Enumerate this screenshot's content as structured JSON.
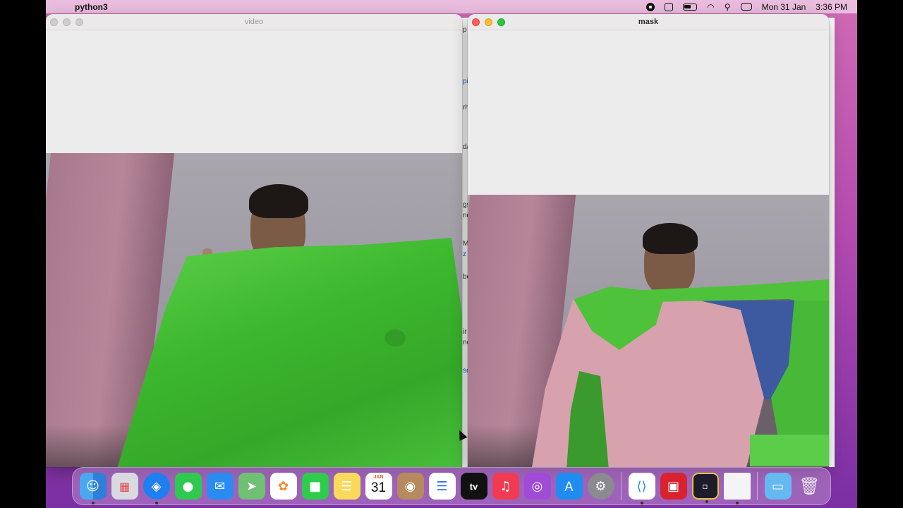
{
  "menubar": {
    "app_name": "python3",
    "date": "Mon 31 Jan",
    "time": "3:36 PM",
    "icons": [
      "apple-icon",
      "screen-record-icon",
      "stop-icon",
      "battery-icon",
      "wifi-icon",
      "search-icon",
      "control-center-icon"
    ]
  },
  "windows": {
    "video": {
      "title": "video"
    },
    "mask": {
      "title": "mask"
    }
  },
  "background_window": {
    "fragments": [
      "p",
      "pi",
      "rh",
      "d/",
      "gs",
      "nd",
      "M",
      "z",
      "be",
      "ir",
      "nc",
      "se"
    ]
  },
  "dock": {
    "calendar_month": "JAN",
    "calendar_day": "31",
    "apple_tv_label": "tv",
    "apps": [
      "Finder",
      "Launchpad",
      "Safari",
      "Messages",
      "Mail",
      "Maps",
      "Photos",
      "FaceTime",
      "Notes",
      "Calendar",
      "Contacts",
      "Reminders",
      "TV",
      "Music",
      "Podcasts",
      "App Store",
      "System Preferences",
      "Visual Studio Code",
      "Photo Booth",
      "Python Launcher",
      "Document",
      "Downloads",
      "Trash"
    ]
  },
  "colors": {
    "accent_green": "#3fbf35",
    "mask_pink": "#d7a2ad"
  }
}
